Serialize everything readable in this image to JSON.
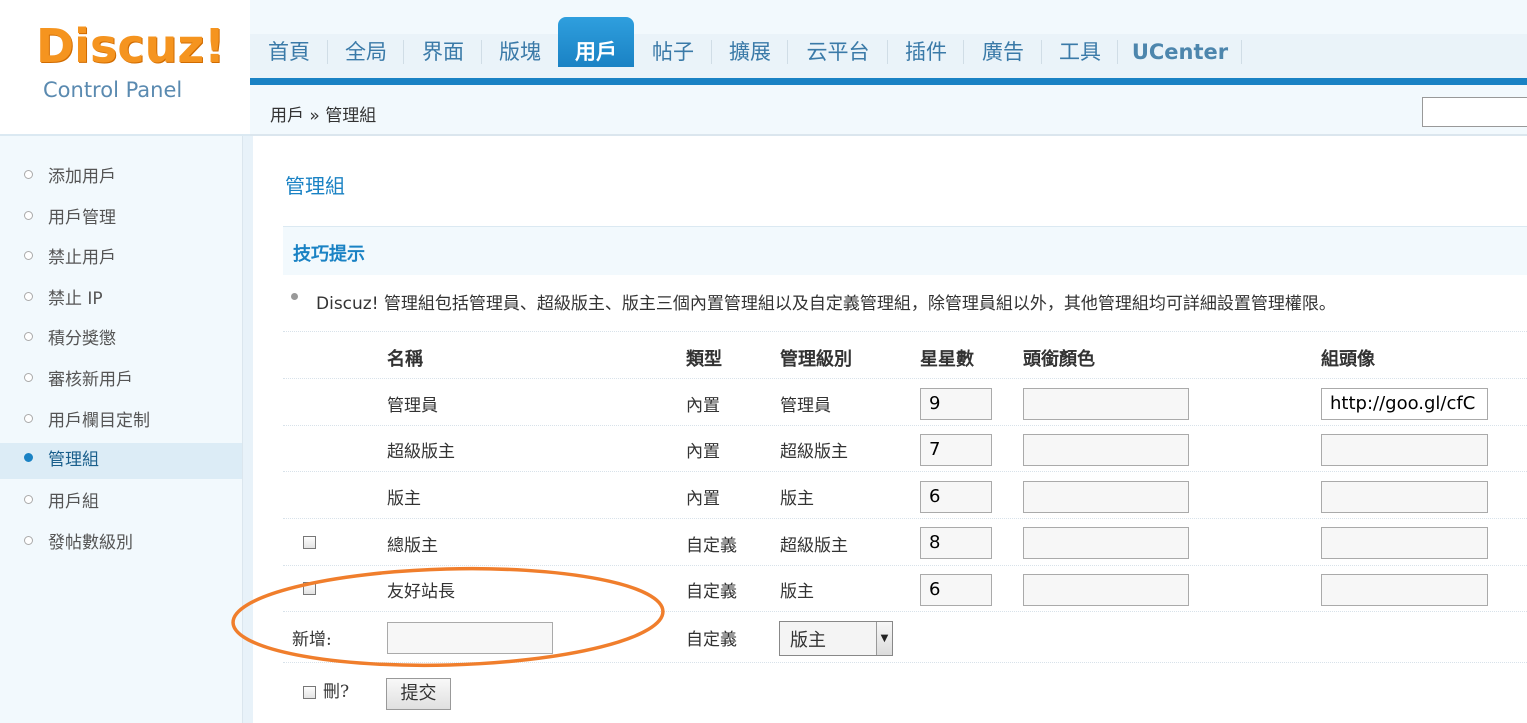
{
  "logo": {
    "title": "Discuz!",
    "subtitle": "Control Panel"
  },
  "nav": {
    "items": [
      "首頁",
      "全局",
      "界面",
      "版塊",
      "用戶",
      "帖子",
      "擴展",
      "云平台",
      "插件",
      "廣告",
      "工具",
      "UCenter"
    ],
    "active": "用戶"
  },
  "breadcrumb": "用戶 » 管理組",
  "sidebar": {
    "items": [
      "添加用戶",
      "用戶管理",
      "禁止用戶",
      "禁止 IP",
      "積分獎懲",
      "審核新用戶",
      "用戶欄目定制",
      "管理組",
      "用戶組",
      "發帖數級別"
    ],
    "active": "管理組"
  },
  "page": {
    "title": "管理組",
    "tips_title": "技巧提示",
    "tip": "Discuz! 管理組包括管理員、超級版主、版主三個內置管理組以及自定義管理組，除管理員組以外，其他管理組均可詳細設置管理權限。"
  },
  "table": {
    "headers": [
      "名稱",
      "類型",
      "管理級別",
      "星星數",
      "頭銜顏色",
      "組頭像"
    ],
    "rows": [
      {
        "name": "管理員",
        "type": "內置",
        "level": "管理員",
        "stars": "9",
        "color": "",
        "avatar": "http://goo.gl/cfC",
        "checkbox": false
      },
      {
        "name": "超級版主",
        "type": "內置",
        "level": "超級版主",
        "stars": "7",
        "color": "",
        "avatar": "",
        "checkbox": false
      },
      {
        "name": "版主",
        "type": "內置",
        "level": "版主",
        "stars": "6",
        "color": "",
        "avatar": "",
        "checkbox": false
      },
      {
        "name": "總版主",
        "type": "自定義",
        "level": "超級版主",
        "stars": "8",
        "color": "",
        "avatar": "",
        "checkbox": true
      },
      {
        "name": "友好站長",
        "type": "自定義",
        "level": "版主",
        "stars": "6",
        "color": "",
        "avatar": "",
        "checkbox": true
      }
    ],
    "new_row": {
      "label": "新增:",
      "type": "自定義",
      "level_selected": "版主",
      "name_value": ""
    },
    "delete_label": "刪?",
    "submit_label": "提交"
  },
  "colors": {
    "accent": "#1a82c4",
    "logo": "#f5941f",
    "annotation": "#f07e2c"
  }
}
